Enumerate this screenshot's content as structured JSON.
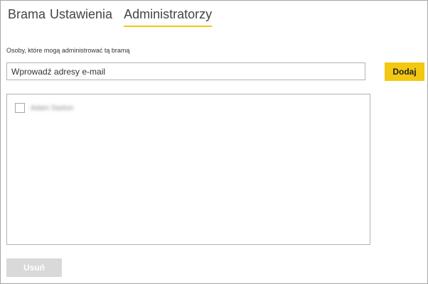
{
  "tabs": [
    {
      "label": "Brama",
      "active": false
    },
    {
      "label": "Ustawienia",
      "active": false
    },
    {
      "label": "Administratorzy",
      "active": true
    }
  ],
  "admins": {
    "subtitle": "Osoby, które mogą administrować tą bramą",
    "email_placeholder": "Wprowadź adresy e-mail",
    "add_label": "Dodaj",
    "users": [
      {
        "name": "Adam Saxton",
        "checked": false
      }
    ],
    "remove_label": "Usuń"
  },
  "colors": {
    "accent": "#f2c811",
    "disabled_button": "#d9d9d9",
    "border": "#b3b3b3"
  }
}
